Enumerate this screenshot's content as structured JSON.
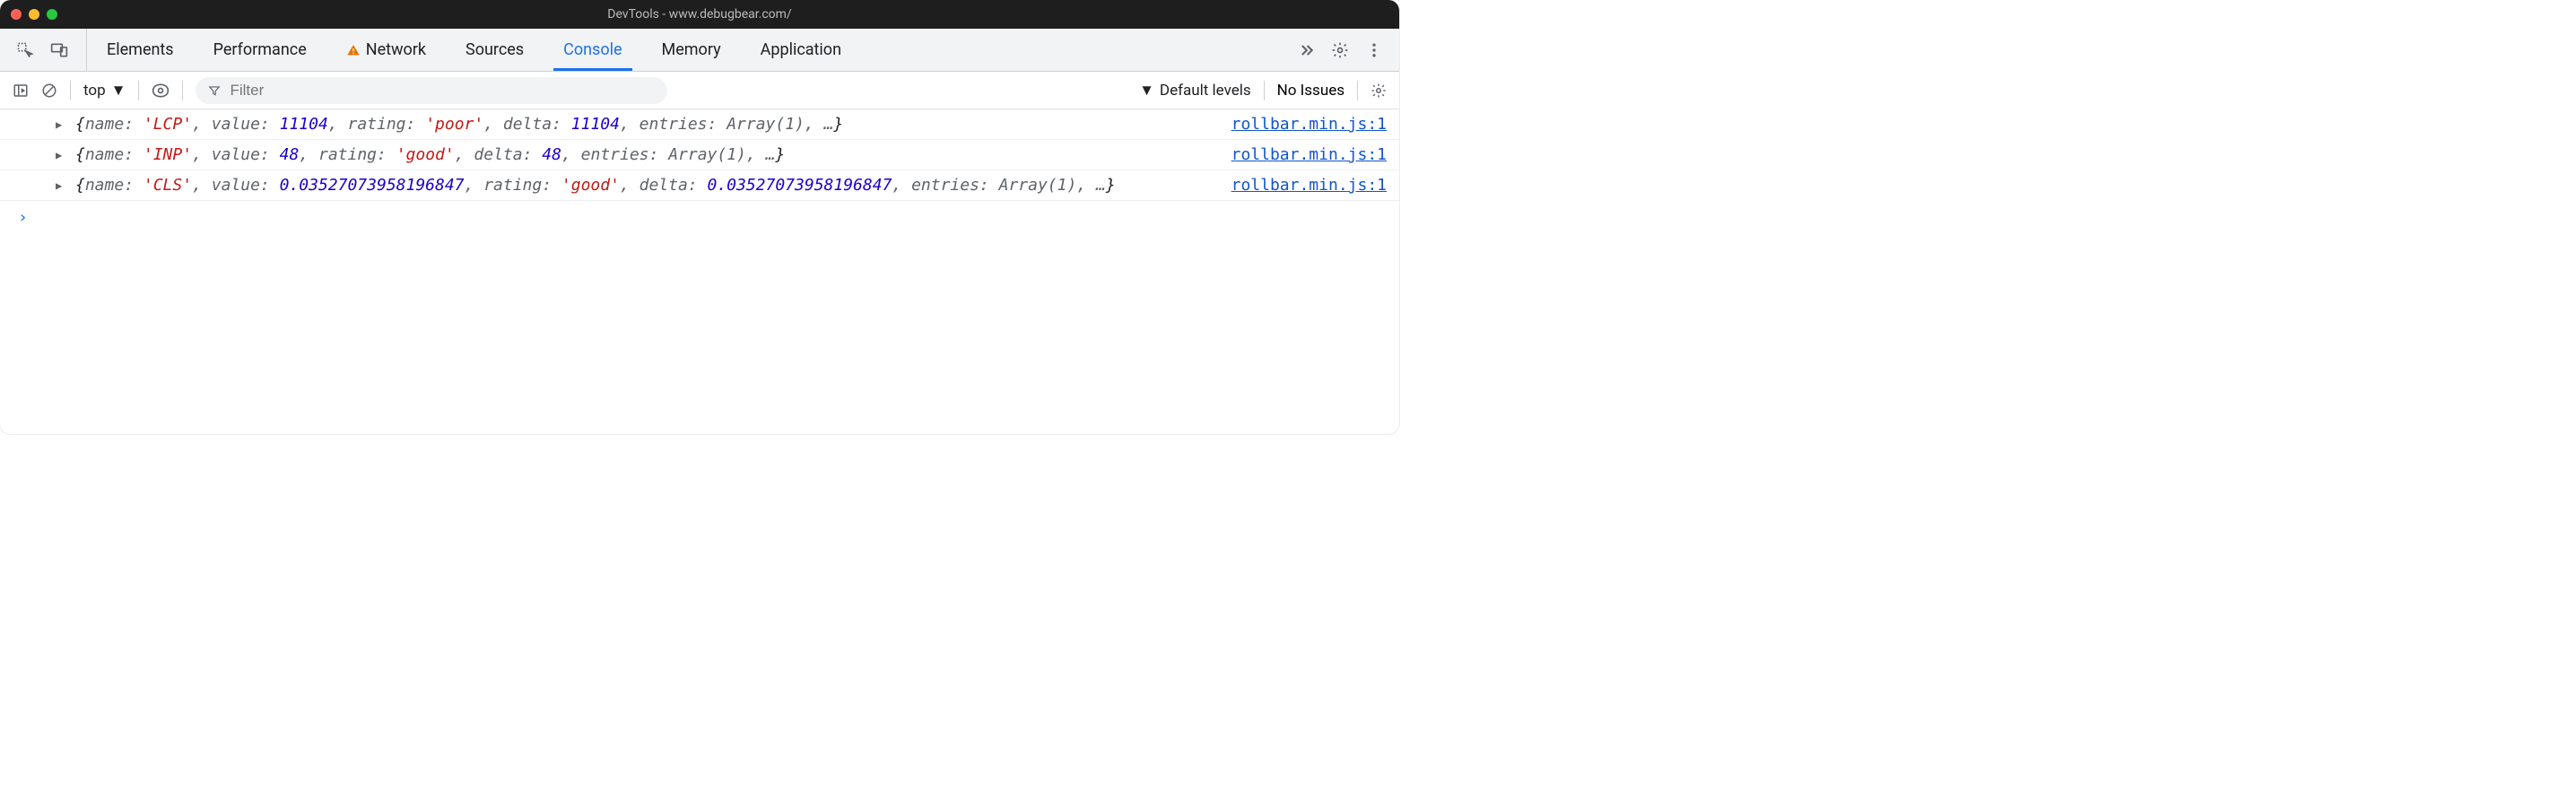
{
  "window": {
    "title": "DevTools - www.debugbear.com/"
  },
  "tabs": [
    {
      "label": "Elements",
      "active": false,
      "warning": false
    },
    {
      "label": "Performance",
      "active": false,
      "warning": false
    },
    {
      "label": "Network",
      "active": false,
      "warning": true
    },
    {
      "label": "Sources",
      "active": false,
      "warning": false
    },
    {
      "label": "Console",
      "active": true,
      "warning": false
    },
    {
      "label": "Memory",
      "active": false,
      "warning": false
    },
    {
      "label": "Application",
      "active": false,
      "warning": false
    }
  ],
  "toolbar": {
    "context": "top",
    "filter_placeholder": "Filter",
    "levels_label": "Default levels",
    "issues_label": "No Issues"
  },
  "logs": [
    {
      "source": "rollbar.min.js:1",
      "source_float": false,
      "entry": {
        "name": "'LCP'",
        "value": "11104",
        "rating": "'poor'",
        "delta": "11104",
        "entries": "Array(1)",
        "trailing": "…"
      }
    },
    {
      "source": "rollbar.min.js:1",
      "source_float": false,
      "entry": {
        "name": "'INP'",
        "value": "48",
        "rating": "'good'",
        "delta": "48",
        "entries": "Array(1)",
        "trailing": "…"
      }
    },
    {
      "source": "rollbar.min.js:1",
      "source_float": true,
      "entry": {
        "name": "'CLS'",
        "value": "0.03527073958196847",
        "rating": "'good'",
        "delta": "0.03527073958196847",
        "entries": "Array(1)",
        "trailing": "…"
      }
    }
  ],
  "prompt": "›"
}
